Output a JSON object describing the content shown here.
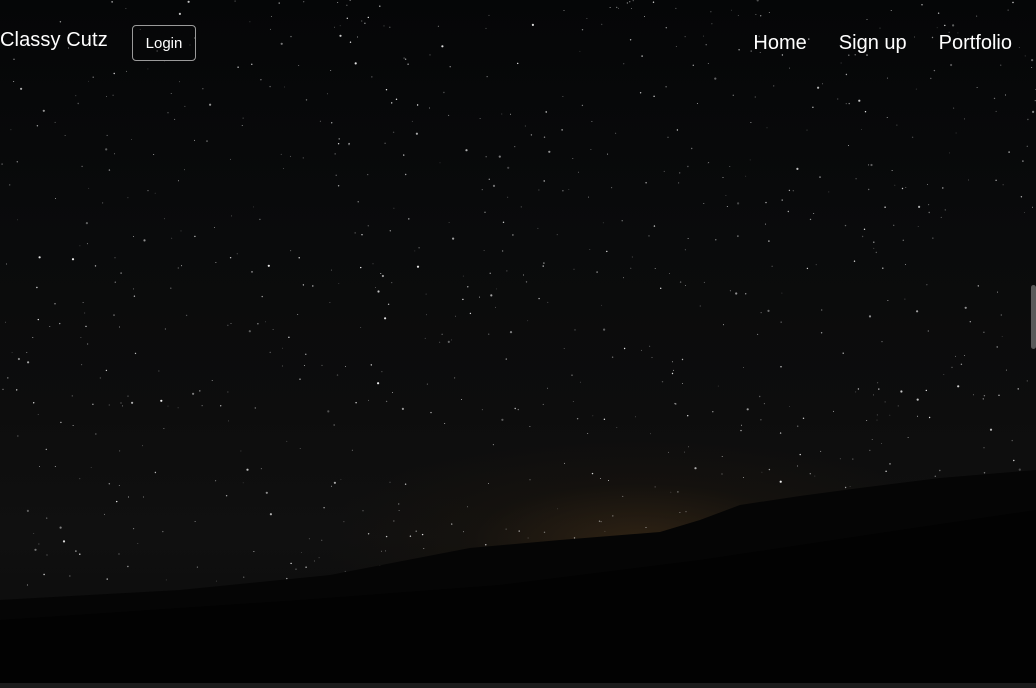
{
  "navbar": {
    "brand": "Classy Cutz",
    "login_label": "Login",
    "links": [
      {
        "label": "Home"
      },
      {
        "label": "Sign up"
      },
      {
        "label": "Portfolio"
      }
    ]
  },
  "colors": {
    "text": "#ffffff",
    "background": "#000000",
    "button_border": "#9a9a9a"
  }
}
